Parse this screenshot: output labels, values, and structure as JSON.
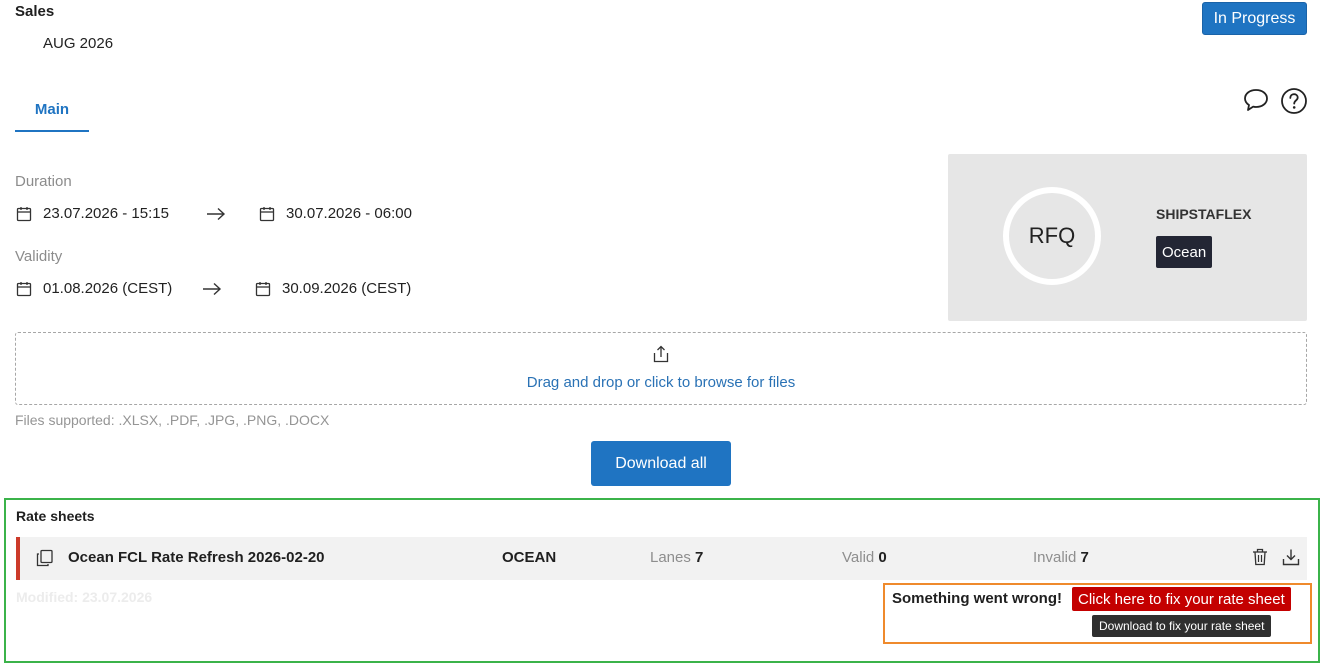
{
  "header": {
    "section": "Sales",
    "period": "AUG 2026",
    "status": "In Progress"
  },
  "tabs": [
    {
      "label": "Main",
      "active": true
    }
  ],
  "duration": {
    "label": "Duration",
    "start": "23.07.2026 - 15:15",
    "end": "30.07.2026 - 06:00"
  },
  "validity": {
    "label": "Validity",
    "start": "01.08.2026 (CEST)",
    "end": "30.09.2026 (CEST)"
  },
  "rfq": {
    "badge": "RFQ",
    "carrier": "SHIPSTAFLEX",
    "mode": "Ocean"
  },
  "upload": {
    "prompt": "Drag and drop or click to browse for files",
    "supported": "Files supported: .XLSX, .PDF, .JPG, .PNG, .DOCX"
  },
  "download_all_label": "Download all",
  "rate_sheets": {
    "title": "Rate sheets",
    "items": [
      {
        "name": "Ocean FCL Rate Refresh 2026-02-20",
        "mode": "OCEAN",
        "lanes_label": "Lanes",
        "lanes": "7",
        "valid_label": "Valid",
        "valid": "0",
        "invalid_label": "Invalid",
        "invalid": "7",
        "modified": "Modified:  23.07.2026"
      }
    ]
  },
  "error": {
    "message": "Something went wrong!",
    "fix_label": "Click here to fix your rate sheet",
    "tooltip": "Download to fix your rate sheet"
  },
  "colors": {
    "primary": "#1f74c2",
    "error_red": "#c40000",
    "row_accent": "#cc3a2a",
    "badge_dark": "#232634",
    "highlight_green": "#3bb34a",
    "highlight_orange": "#ef8a2c"
  },
  "icons": {
    "chat": "chat-bubble-icon",
    "help": "help-circle-icon",
    "calendar": "calendar-icon",
    "arrow": "arrow-right-icon",
    "upload": "upload-icon",
    "copy": "copy-document-icon",
    "trash": "trash-icon",
    "download": "download-icon"
  }
}
